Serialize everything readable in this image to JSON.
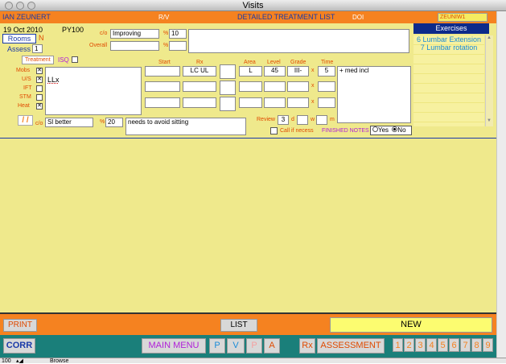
{
  "window": {
    "title": "Visits"
  },
  "header": {
    "patient_name": "IAN ZEUNERT",
    "rv_label": "R/V",
    "list_title": "DETAILED TREATMENT LIST",
    "doi_label": "DOI",
    "user_code": "ZEUNIW1"
  },
  "visit": {
    "date": "19 Oct 2010",
    "code": "PY100",
    "rooms_label": "Rooms",
    "rooms_value": "N",
    "assess_label": "Assess",
    "assess_value": "1"
  },
  "status": {
    "co_label": "c/o",
    "co_value": "Improving",
    "overall_label": "Overall",
    "pct_symbol": "%",
    "pct_value": "10",
    "pct_value2": ""
  },
  "treatment": {
    "label": "Treatment",
    "isq_label": "ISQ",
    "rows": [
      "Mobs",
      "U/S",
      "IFT",
      "STM",
      "Heat"
    ],
    "notes": "LLx"
  },
  "columns": {
    "start": "Start",
    "rx": "Rx",
    "area": "Area",
    "level": "Level",
    "grade": "Grade",
    "time": "Time"
  },
  "row1": {
    "rx": "LC UL",
    "area": "L",
    "level": "45",
    "grade": "III-",
    "times": "x",
    "time": "5",
    "comment": "+ med incl"
  },
  "exercises": {
    "title": "Exercises",
    "items": [
      "6 Lumbar Extension",
      "7 Lumbar rotation"
    ]
  },
  "bottom": {
    "slash": "/ /",
    "co_label": "c/o",
    "co_value": "Sl better",
    "pct_symbol": "%",
    "pct_value": "20",
    "notes": "needs to avoid sitting",
    "review_label": "Review",
    "review_value": "3",
    "d": "d",
    "w": "w",
    "m": "m",
    "call_label": "Call if necess",
    "finished_label": "FINISHED NOTES",
    "yes": "Yes",
    "no": "No"
  },
  "footer": {
    "print": "PRINT",
    "list": "LIST",
    "new": "NEW",
    "corr": "CORR",
    "main_menu": "MAIN MENU",
    "p": "P",
    "v": "V",
    "p2": "P",
    "a": "A",
    "rx": "Rx",
    "assessment": "ASSESSMENT",
    "numbers": [
      "1",
      "2",
      "3",
      "4",
      "5",
      "6",
      "7",
      "8",
      "9"
    ]
  },
  "statusbar": {
    "zoom": "100",
    "mode": "Browse"
  }
}
